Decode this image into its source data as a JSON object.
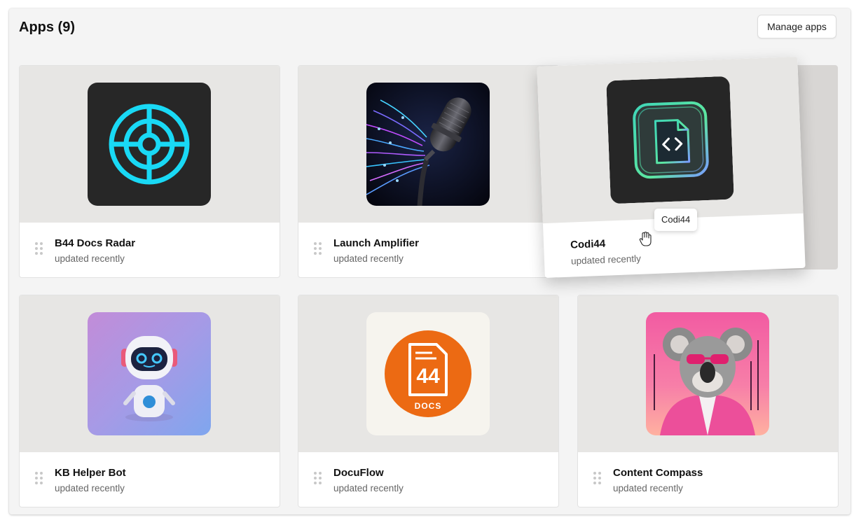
{
  "header": {
    "title": "Apps (9)",
    "manage_label": "Manage apps"
  },
  "apps": [
    {
      "name": "B44 Docs Radar",
      "status": "updated recently",
      "icon": "radar-target-icon"
    },
    {
      "name": "Launch Amplifier",
      "status": "updated recently",
      "icon": "microphone-icon"
    },
    {
      "name": "Codi44",
      "status": "updated recently",
      "icon": "code-file-icon"
    },
    {
      "name": "KB Helper Bot",
      "status": "updated recently",
      "icon": "robot-icon"
    },
    {
      "name": "DocuFlow",
      "status": "updated recently",
      "icon": "docs-44-logo",
      "logo_text": "44",
      "logo_caption": "DOCS"
    },
    {
      "name": "Content Compass",
      "status": "updated recently",
      "icon": "koala-icon"
    }
  ],
  "drag": {
    "tooltip": "Codi44"
  },
  "colors": {
    "panel_bg": "#f4f4f4",
    "thumb_area": "#e7e6e4",
    "radar_cyan": "#19d9f5",
    "docs_orange": "#ec6a13",
    "compass_pink": "#f0559e"
  }
}
